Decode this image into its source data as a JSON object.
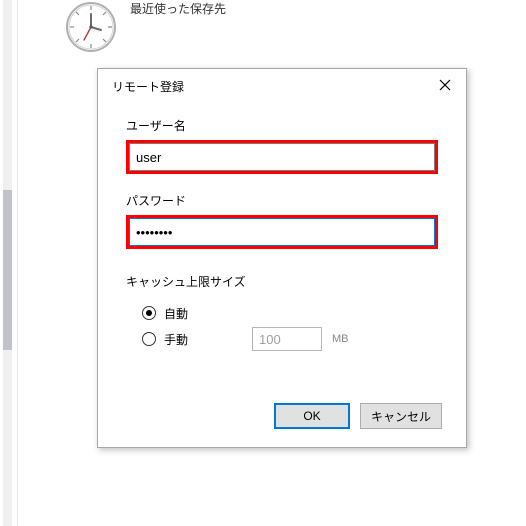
{
  "page": {
    "section_title": "最近使った保存先"
  },
  "dialog": {
    "title": "リモート登録",
    "fields": {
      "username_label": "ユーザー名",
      "username_value": "user",
      "password_label": "パスワード",
      "password_value": "••••••••"
    },
    "cache": {
      "label": "キャッシュ上限サイズ",
      "auto_label": "自動",
      "manual_label": "手動",
      "manual_value": "100",
      "unit": "MB",
      "selected": "auto"
    },
    "buttons": {
      "ok": "OK",
      "cancel": "キャンセル"
    }
  }
}
